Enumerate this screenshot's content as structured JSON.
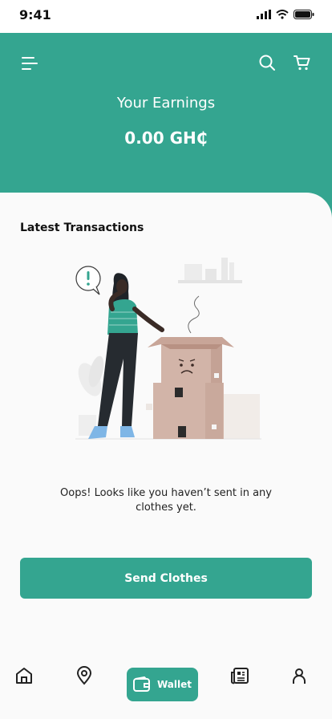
{
  "status_bar": {
    "time": "9:41"
  },
  "header": {
    "earnings_title": "Your Earnings",
    "earnings_value": "0.00 GH₵"
  },
  "transactions": {
    "title": "Latest Transactions",
    "empty_message": "Oops! Looks like you haven’t sent in any clothes yet."
  },
  "actions": {
    "send_label": "Send Clothes"
  },
  "bottom_nav": {
    "items": [
      {
        "icon": "home-icon"
      },
      {
        "icon": "location-pin-icon"
      },
      {
        "icon": "wallet-icon",
        "label": "Wallet",
        "active": true
      },
      {
        "icon": "news-icon"
      },
      {
        "icon": "profile-icon"
      }
    ]
  },
  "colors": {
    "brand": "#34a590",
    "background": "#fafafa"
  }
}
